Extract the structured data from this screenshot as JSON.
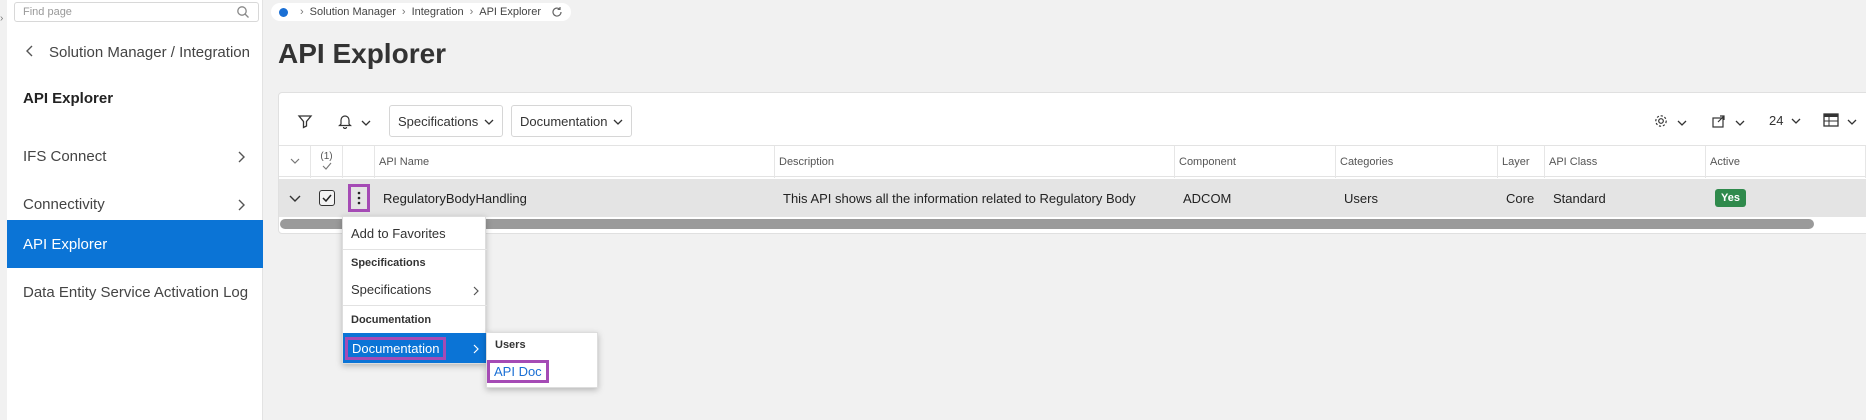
{
  "search": {
    "placeholder": "Find page"
  },
  "nav": {
    "back_label": "Solution Manager / Integration",
    "heading": "API Explorer",
    "items": [
      {
        "label": "IFS Connect",
        "has_children": true,
        "active": false
      },
      {
        "label": "Connectivity",
        "has_children": true,
        "active": false
      },
      {
        "label": "API Explorer",
        "has_children": false,
        "active": true
      },
      {
        "label": "Data Entity Service Activation Log",
        "has_children": false,
        "active": false
      }
    ]
  },
  "breadcrumb": [
    "Solution Manager",
    "Integration",
    "API Explorer"
  ],
  "page": {
    "title": "API Explorer"
  },
  "toolbar": {
    "specifications_label": "Specifications",
    "documentation_label": "Documentation",
    "page_size": "24"
  },
  "table": {
    "selected_count": "(1)",
    "columns": [
      "API Name",
      "Description",
      "Component",
      "Categories",
      "Layer",
      "API Class",
      "Active"
    ],
    "rows": [
      {
        "api_name": "RegulatoryBodyHandling",
        "description": "This API shows all the information related to Regulatory Body",
        "component": "ADCOM",
        "categories": "Users",
        "layer": "Core",
        "api_class": "Standard",
        "active": "Yes"
      }
    ]
  },
  "context_menu": {
    "add_favorites": "Add to Favorites",
    "specifications_header": "Specifications",
    "specifications_item": "Specifications",
    "documentation_header": "Documentation",
    "documentation_item": "Documentation"
  },
  "submenu": {
    "header": "Users",
    "link": "API Doc"
  },
  "colors": {
    "accent": "#0b74d6",
    "highlight": "#a54bb5",
    "active_badge": "#2f8a4c"
  }
}
